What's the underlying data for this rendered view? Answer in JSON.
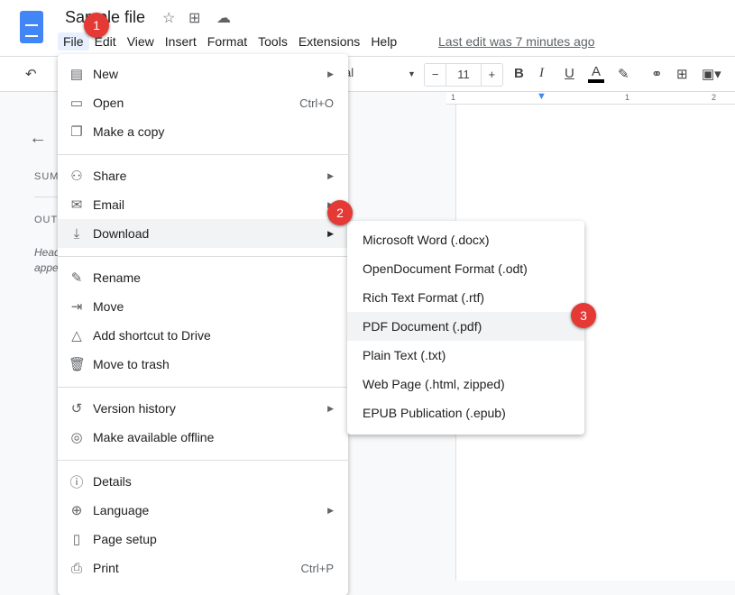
{
  "app": {
    "title": "Sample file",
    "last_edit": "Last edit was 7 minutes ago",
    "icons": [
      "star-icon",
      "move-to-folder-icon",
      "cloud-saved-icon"
    ]
  },
  "menubar": [
    "File",
    "Edit",
    "View",
    "Insert",
    "Format",
    "Tools",
    "Extensions",
    "Help"
  ],
  "toolbar": {
    "font_partial": "al",
    "font_size": "11",
    "minus": "−",
    "plus": "+",
    "bold": "B",
    "italic": "I",
    "underline": "U",
    "text_color": "A",
    "text_color_value": "#000000"
  },
  "ruler": {
    "labels": [
      "1",
      "1",
      "2"
    ]
  },
  "sidebar": {
    "summary": "SUM",
    "outline": "OUTI",
    "hint1": "Head",
    "hint2": "appe"
  },
  "file_menu": [
    {
      "label": "New",
      "icon": "document-icon",
      "submenu": true
    },
    {
      "label": "Open",
      "icon": "folder-icon",
      "shortcut": "Ctrl+O"
    },
    {
      "label": "Make a copy",
      "icon": "copy-icon"
    },
    {
      "label": "Share",
      "icon": "person-add-icon",
      "submenu": true
    },
    {
      "label": "Email",
      "icon": "email-icon",
      "submenu": true
    },
    {
      "label": "Download",
      "icon": "download-icon",
      "submenu": true,
      "highlighted": true
    },
    {
      "label": "Rename",
      "icon": "rename-icon"
    },
    {
      "label": "Move",
      "icon": "move-icon"
    },
    {
      "label": "Add shortcut to Drive",
      "icon": "drive-shortcut-icon"
    },
    {
      "label": "Move to trash",
      "icon": "trash-icon"
    },
    {
      "label": "Version history",
      "icon": "history-icon",
      "submenu": true
    },
    {
      "label": "Make available offline",
      "icon": "offline-icon"
    },
    {
      "label": "Details",
      "icon": "info-icon"
    },
    {
      "label": "Language",
      "icon": "globe-icon",
      "submenu": true
    },
    {
      "label": "Page setup",
      "icon": "page-setup-icon"
    },
    {
      "label": "Print",
      "icon": "print-icon",
      "shortcut": "Ctrl+P"
    }
  ],
  "download_menu": [
    {
      "label": "Microsoft Word (.docx)"
    },
    {
      "label": "OpenDocument Format (.odt)"
    },
    {
      "label": "Rich Text Format (.rtf)"
    },
    {
      "label": "PDF Document (.pdf)",
      "highlighted": true
    },
    {
      "label": "Plain Text (.txt)"
    },
    {
      "label": "Web Page (.html, zipped)"
    },
    {
      "label": "EPUB Publication (.epub)"
    }
  ],
  "annotations": [
    "1",
    "2",
    "3"
  ],
  "colors": {
    "badge": "#e53935",
    "brand": "#4285f4",
    "highlight": "#f1f3f4"
  }
}
